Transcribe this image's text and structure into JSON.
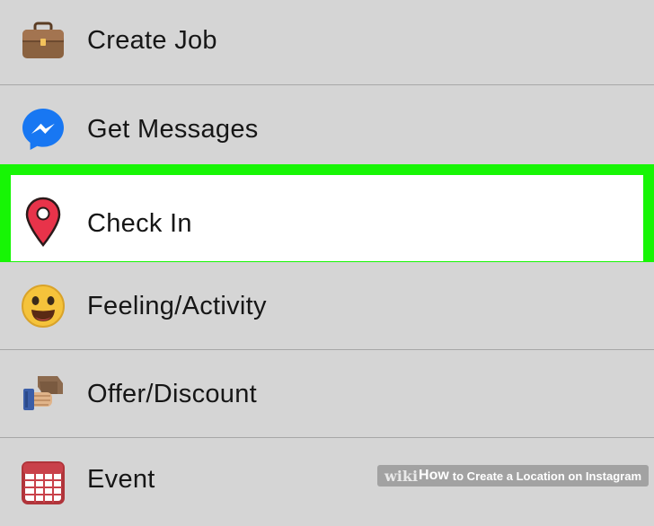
{
  "menu": {
    "items": [
      {
        "label": "Create Job",
        "icon": "briefcase-icon"
      },
      {
        "label": "Get Messages",
        "icon": "messenger-icon"
      },
      {
        "label": "Check In",
        "icon": "location-pin-icon",
        "highlighted": true,
        "highlight_color": "#17f505"
      },
      {
        "label": "Feeling/Activity",
        "icon": "smiley-face-icon"
      },
      {
        "label": "Offer/Discount",
        "icon": "offer-tag-hand-icon"
      },
      {
        "label": "Event",
        "icon": "calendar-event-icon"
      }
    ]
  },
  "watermark": {
    "wiki": "wiki",
    "how": "How",
    "title": "to Create a Location on Instagram"
  },
  "colors": {
    "background": "#d5d5d5",
    "highlight_border": "#17f505",
    "divider": "#a7a7a7",
    "messenger_blue": "#1877f2",
    "pin_red": "#e8334a"
  }
}
